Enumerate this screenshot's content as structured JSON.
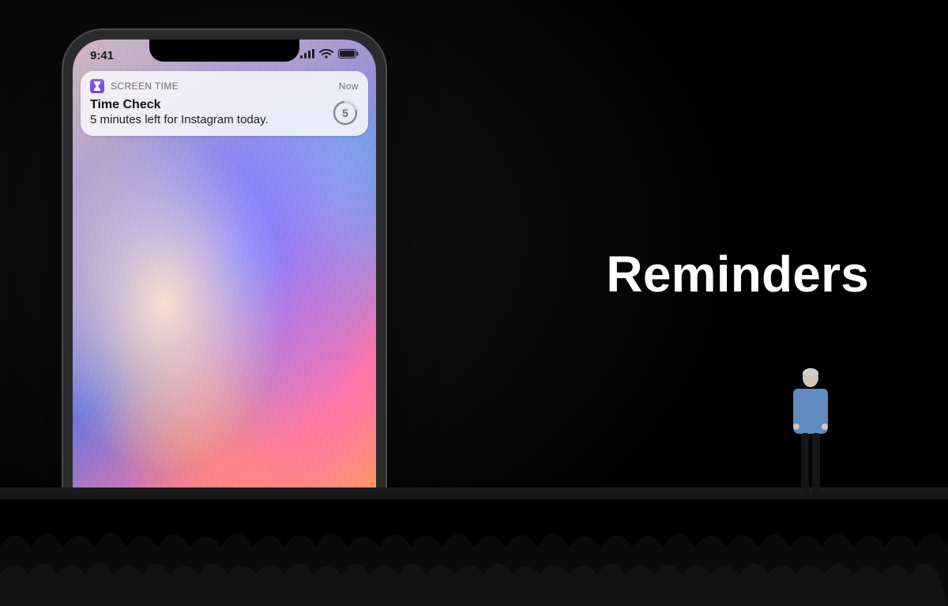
{
  "slide": {
    "headline": "Reminders"
  },
  "phone": {
    "status": {
      "time": "9:41"
    },
    "notification": {
      "app_name": "SCREEN TIME",
      "timestamp": "Now",
      "title": "Time Check",
      "body": "5 minutes left for Instagram today.",
      "countdown_minutes": "5"
    }
  },
  "icons": {
    "hourglass": "hourglass-icon",
    "signal": "cell-signal-icon",
    "wifi": "wifi-icon",
    "battery": "battery-icon",
    "countdown": "countdown-ring-icon"
  }
}
